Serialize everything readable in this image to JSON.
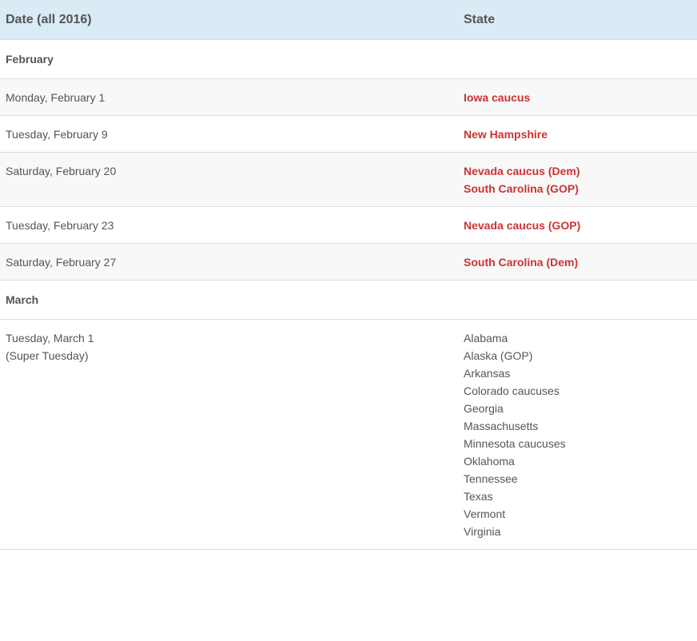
{
  "header": {
    "date_col": "Date (all 2016)",
    "state_col": "State"
  },
  "months": [
    {
      "name": "February",
      "rows": [
        {
          "date": [
            "Monday, February 1"
          ],
          "states": [
            {
              "text": "Iowa caucus",
              "link": true
            }
          ]
        },
        {
          "date": [
            "Tuesday, February 9"
          ],
          "states": [
            {
              "text": "New Hampshire",
              "link": true
            }
          ]
        },
        {
          "date": [
            "Saturday, February 20"
          ],
          "states": [
            {
              "text": "Nevada caucus (Dem)",
              "link": true
            },
            {
              "text": "South Carolina (GOP)",
              "link": true
            }
          ]
        },
        {
          "date": [
            "Tuesday, February 23"
          ],
          "states": [
            {
              "text": "Nevada caucus (GOP)",
              "link": true
            }
          ]
        },
        {
          "date": [
            "Saturday, February 27"
          ],
          "states": [
            {
              "text": "South Carolina (Dem)",
              "link": true
            }
          ]
        }
      ]
    },
    {
      "name": "March",
      "rows": [
        {
          "date": [
            "Tuesday, March 1",
            "(Super Tuesday)"
          ],
          "states": [
            {
              "text": "Alabama",
              "link": false
            },
            {
              "text": "Alaska (GOP)",
              "link": false
            },
            {
              "text": "Arkansas",
              "link": false
            },
            {
              "text": "Colorado caucuses",
              "link": false
            },
            {
              "text": "Georgia",
              "link": false
            },
            {
              "text": "Massachusetts",
              "link": false
            },
            {
              "text": "Minnesota caucuses",
              "link": false
            },
            {
              "text": "Oklahoma",
              "link": false
            },
            {
              "text": "Tennessee",
              "link": false
            },
            {
              "text": "Texas",
              "link": false
            },
            {
              "text": "Vermont",
              "link": false
            },
            {
              "text": "Virginia",
              "link": false
            }
          ]
        }
      ]
    }
  ]
}
